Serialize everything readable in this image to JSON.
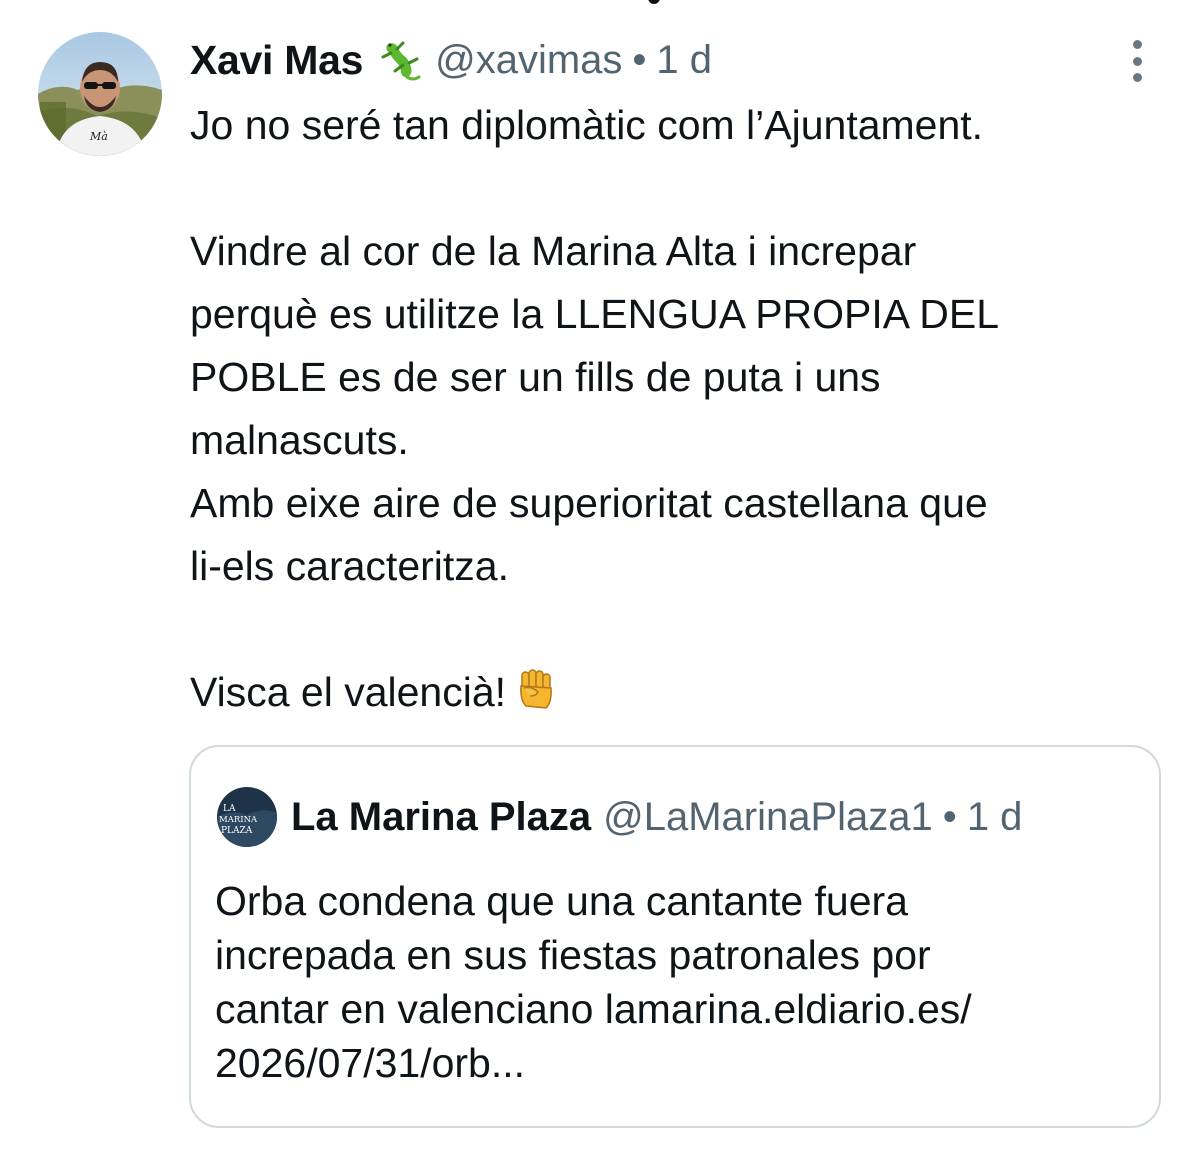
{
  "tweet": {
    "author": {
      "name": "Xavi Mas",
      "name_emoji": "lizard-icon",
      "handle": "@xavimas",
      "separator": "•",
      "time": "1 d"
    },
    "more_icon": "more-vertical-icon",
    "text": {
      "line1": "Jo no seré tan diplomàtic com l’Ajuntament.",
      "line2": "Vindre al cor de la Marina Alta i increpar",
      "line3": "perquè es utilitze la LLENGUA PROPIA DEL",
      "line4": "POBLE es de ser un fills de puta i uns",
      "line5": "malnascuts.",
      "line6": "Amb eixe aire de superioritat castellana que",
      "line7": "li-els caracteritza.",
      "line8": "Visca el valencià!",
      "line8_emoji": "raised-fist-icon"
    }
  },
  "quoted_tweet": {
    "author": {
      "name": "La Marina Plaza",
      "handle": "@LaMarinaPlaza1",
      "separator": "•",
      "time": "1 d",
      "avatar_text": [
        "LA",
        "MARINA",
        "PLAZA"
      ]
    },
    "text": {
      "line1": "Orba condena que una cantante fuera",
      "line2": "increpada en sus fiestas patronales por",
      "line3": "cantar en valenciano lamarina.eldiario.es/",
      "line4": "2026/07/31/orb..."
    }
  },
  "colors": {
    "text_primary": "#0f1419",
    "text_secondary": "#536471",
    "border": "#cfd9de",
    "background": "#ffffff"
  }
}
